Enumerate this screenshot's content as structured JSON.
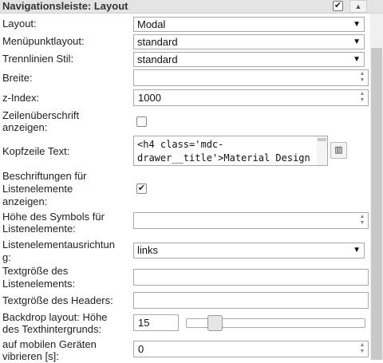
{
  "header": {
    "title": "Navigationsleiste: Layout",
    "check_glyph": "✔",
    "collapse_glyph": "▲"
  },
  "fields": {
    "layout": {
      "label": "Layout:",
      "value": "Modal"
    },
    "menu_item_layout": {
      "label": "Menüpunktlayout:",
      "value": "standard"
    },
    "separator_style": {
      "label": "Trennlinien Stil:",
      "value": "standard"
    },
    "width": {
      "label": "Breite:",
      "value": ""
    },
    "z_index": {
      "label": "z-Index:",
      "value": "1000"
    },
    "row_heading": {
      "label_line1": "Zeilenüberschrift",
      "label_line2": "anzeigen:",
      "checked": false
    },
    "header_text": {
      "label": "Kopfzeile Text:",
      "value": "<h4 class='mdc-\ndrawer__title'>Material Design"
    },
    "show_item_labels": {
      "label_line1": "Beschriftungen für",
      "label_line2": "Listenelemente",
      "label_line3": "anzeigen:",
      "checked": true,
      "check_glyph": "✔"
    },
    "icon_height": {
      "label_line1": "Höhe des Symbols für",
      "label_line2": "Listenelemente:",
      "value": ""
    },
    "item_alignment": {
      "label_line1": "Listenelementausrichtun",
      "label_line2": "g:",
      "value": "links"
    },
    "item_font_size": {
      "label_line1": "Textgröße des",
      "label_line2": "Listenelements:",
      "value": ""
    },
    "header_font_size": {
      "label": "Textgröße des Headers:",
      "value": ""
    },
    "backdrop_height": {
      "label_line1": "Backdrop layout: Höhe",
      "label_line2": "des Texthintergrunds:",
      "value": "15",
      "slider_fraction": 0.13
    },
    "vibrate_mobile": {
      "label_line1": "auf mobilen Geräten",
      "label_line2": "vibrieren [s]:",
      "value": "0"
    }
  },
  "icons": {
    "dropdown_arrow": "▼",
    "spin_up": "▲",
    "spin_down": "▼",
    "editor_button": "▥"
  }
}
